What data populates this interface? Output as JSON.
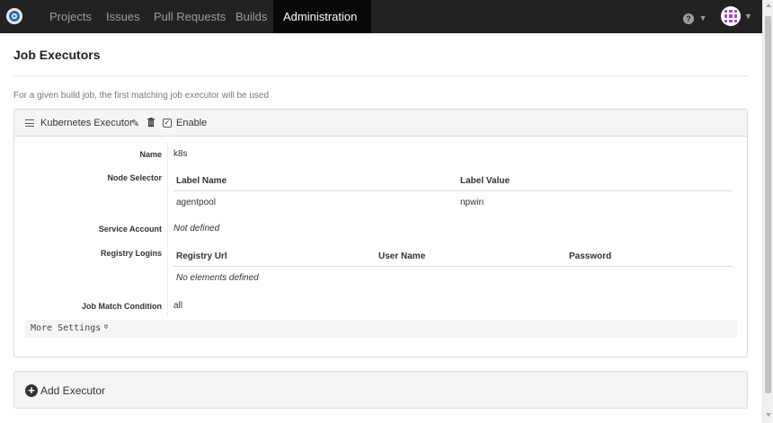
{
  "nav": {
    "items": [
      {
        "label": "Projects"
      },
      {
        "label": "Issues"
      },
      {
        "label": "Pull Requests"
      },
      {
        "label": "Builds"
      }
    ],
    "active": {
      "label": "Administration"
    },
    "help_icon": "question-circle-icon",
    "avatar_icon": "user-avatar-icon"
  },
  "page": {
    "title": "Job Executors",
    "hint": "For a given build job, the first matching job executor will be used"
  },
  "executor": {
    "title": "Kubernetes Executor",
    "enable_label": "Enable",
    "enabled": true,
    "fields": {
      "name": {
        "label": "Name",
        "value": "k8s"
      },
      "node_selector": {
        "label": "Node Selector",
        "columns": [
          "Label Name",
          "Label Value"
        ],
        "rows": [
          [
            "agentpool",
            "npwin"
          ]
        ]
      },
      "service_account": {
        "label": "Service Account",
        "value": "Not defined"
      },
      "registry_logins": {
        "label": "Registry Logins",
        "columns": [
          "Registry Url",
          "User Name",
          "Password"
        ],
        "empty": "No elements defined"
      },
      "job_match": {
        "label": "Job Match Condition",
        "value": "all"
      }
    },
    "more_settings": "More Settings"
  },
  "add_executor": "Add Executor",
  "colors": {
    "navbar": "#222222",
    "active_nav": "#080808",
    "panel_header": "#f5f5f5",
    "border": "#dddddd"
  }
}
